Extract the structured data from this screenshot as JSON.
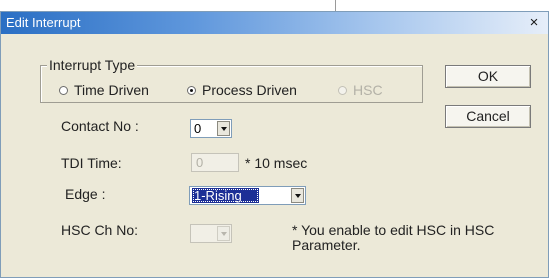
{
  "dialog": {
    "title": "Edit Interrupt",
    "close_label": "×"
  },
  "interrupt_type": {
    "legend": "Interrupt Type",
    "options": [
      {
        "label": "Time Driven",
        "selected": false,
        "enabled": true
      },
      {
        "label": "Process Driven",
        "selected": true,
        "enabled": true
      },
      {
        "label": "HSC",
        "selected": false,
        "enabled": false
      }
    ]
  },
  "buttons": {
    "ok_label": "OK",
    "cancel_label": "Cancel"
  },
  "contact_no": {
    "label": "Contact No :",
    "value": "0"
  },
  "tdi_time": {
    "label": "TDI Time:",
    "value": "0",
    "unit": "* 10 msec"
  },
  "edge": {
    "label": "Edge :",
    "value": "1-Rising"
  },
  "hsc_ch_no": {
    "label": "HSC Ch No:",
    "value": "",
    "note_line1": "* You enable to edit HSC in HSC",
    "note_line2": "Parameter."
  },
  "icons": {
    "close": "close-icon",
    "dropdown": "chevron-down-icon"
  }
}
